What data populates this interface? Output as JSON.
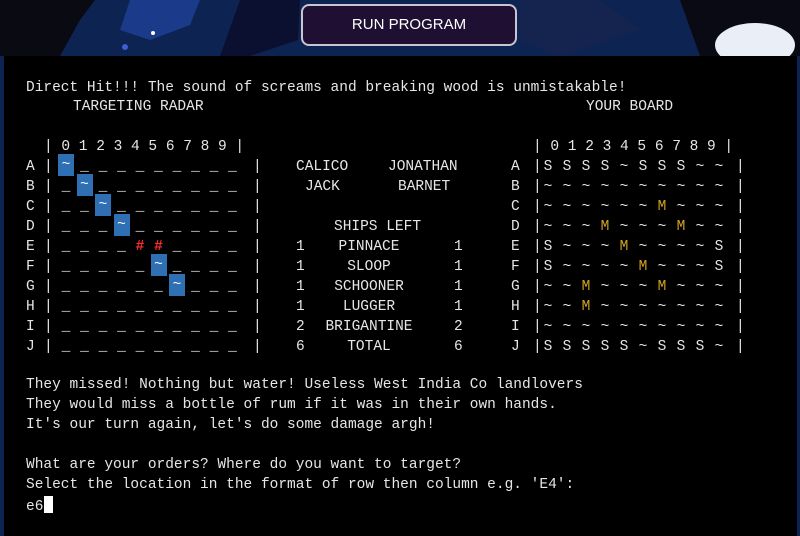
{
  "run_button_label": "RUN PROGRAM",
  "terminal": {
    "message_top": "Direct Hit!!! The sound of screams and breaking wood is unmistakable!",
    "radar_title": "TARGETING RADAR",
    "board_title": "YOUR BOARD",
    "column_header": "| 0 1 2 3 4 5 6 7 8 9 |",
    "row_labels": [
      "A",
      "B",
      "C",
      "D",
      "E",
      "F",
      "G",
      "H",
      "I",
      "J"
    ],
    "radar_rows": [
      [
        "~",
        "_",
        "_",
        "_",
        "_",
        "_",
        "_",
        "_",
        "_",
        "_"
      ],
      [
        "_",
        "~",
        "_",
        "_",
        "_",
        "_",
        "_",
        "_",
        "_",
        "_"
      ],
      [
        "_",
        "_",
        "~",
        "_",
        "_",
        "_",
        "_",
        "_",
        "_",
        "_"
      ],
      [
        "_",
        "_",
        "_",
        "~",
        "_",
        "_",
        "_",
        "_",
        "_",
        "_"
      ],
      [
        "_",
        "_",
        "_",
        "_",
        "#",
        "#",
        "_",
        "_",
        "_",
        "_"
      ],
      [
        "_",
        "_",
        "_",
        "_",
        "_",
        "~",
        "_",
        "_",
        "_",
        "_"
      ],
      [
        "_",
        "_",
        "_",
        "_",
        "_",
        "_",
        "~",
        "_",
        "_",
        "_"
      ],
      [
        "_",
        "_",
        "_",
        "_",
        "_",
        "_",
        "_",
        "_",
        "_",
        "_"
      ],
      [
        "_",
        "_",
        "_",
        "_",
        "_",
        "_",
        "_",
        "_",
        "_",
        "_"
      ],
      [
        "_",
        "_",
        "_",
        "_",
        "_",
        "_",
        "_",
        "_",
        "_",
        "_"
      ]
    ],
    "board_rows": [
      [
        "S",
        "S",
        "S",
        "S",
        "~",
        "S",
        "S",
        "S",
        "~",
        "~"
      ],
      [
        "~",
        "~",
        "~",
        "~",
        "~",
        "~",
        "~",
        "~",
        "~",
        "~"
      ],
      [
        "~",
        "~",
        "~",
        "~",
        "~",
        "~",
        "M",
        "~",
        "~",
        "~"
      ],
      [
        "~",
        "~",
        "~",
        "M",
        "~",
        "~",
        "~",
        "M",
        "~",
        "~"
      ],
      [
        "S",
        "~",
        "~",
        "~",
        "M",
        "~",
        "~",
        "~",
        "~",
        "S"
      ],
      [
        "S",
        "~",
        "~",
        "~",
        "~",
        "M",
        "~",
        "~",
        "~",
        "S"
      ],
      [
        "~",
        "~",
        "M",
        "~",
        "~",
        "~",
        "M",
        "~",
        "~",
        "~"
      ],
      [
        "~",
        "~",
        "M",
        "~",
        "~",
        "~",
        "~",
        "~",
        "~",
        "~"
      ],
      [
        "~",
        "~",
        "~",
        "~",
        "~",
        "~",
        "~",
        "~",
        "~",
        "~"
      ],
      [
        "S",
        "S",
        "S",
        "S",
        "S",
        "~",
        "S",
        "S",
        "S",
        "~"
      ]
    ],
    "players": [
      "CALICO",
      "JONATHAN",
      "JACK",
      "BARNET"
    ],
    "ships_left_title": "SHIPS LEFT",
    "ships": [
      {
        "left": "1",
        "name": "PINNACE",
        "right": "1"
      },
      {
        "left": "1",
        "name": "SLOOP",
        "right": "1"
      },
      {
        "left": "1",
        "name": "SCHOONER",
        "right": "1"
      },
      {
        "left": "1",
        "name": "LUGGER",
        "right": "1"
      },
      {
        "left": "2",
        "name": "BRIGANTINE",
        "right": "2"
      },
      {
        "left": "6",
        "name": "TOTAL",
        "right": "6"
      }
    ],
    "message_lines": [
      "They missed! Nothing but water! Useless West India Co landlovers",
      "They would miss a bottle of rum if it was in their own hands.",
      "It's our turn again, let's do some damage argh!"
    ],
    "prompt_lines": [
      "What are your orders? Where do you want to target?",
      "Select the location in the format of row then column e.g. 'E4':"
    ],
    "input_value": "e6",
    "colors": {
      "highlight": "#2f6fb3",
      "hit": "#ff2b2b",
      "miss": "#d1a321"
    }
  }
}
